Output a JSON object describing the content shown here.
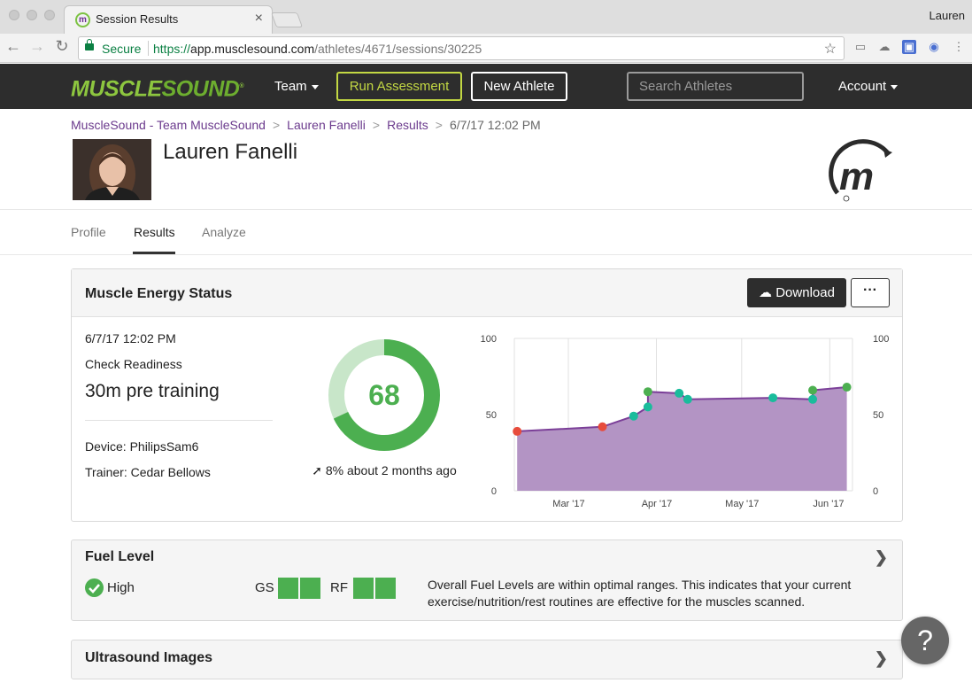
{
  "browser": {
    "tab_title": "Session Results",
    "tab_favicon": "m",
    "profile_name": "Lauren",
    "security_label": "Secure",
    "url_scheme": "https://",
    "url_host": "app.musclesound.com",
    "url_path": "/athletes/4671/sessions/30225"
  },
  "navbar": {
    "logo_part1": "MUSCLE",
    "logo_part2": "SOUND",
    "logo_mark": "®",
    "team_label": "Team",
    "run_assessment_label": "Run Assessment",
    "new_athlete_label": "New Athlete",
    "search_placeholder": "Search Athletes",
    "account_label": "Account"
  },
  "breadcrumb": {
    "items": [
      "MuscleSound - Team MuscleSound",
      "Lauren Fanelli",
      "Results"
    ],
    "current": "6/7/17 12:02 PM",
    "separator": ">"
  },
  "athlete": {
    "name": "Lauren Fanelli"
  },
  "tabs": [
    "Profile",
    "Results",
    "Analyze"
  ],
  "active_tab": "Results",
  "muscle_energy": {
    "title": "Muscle Energy Status",
    "download_label": "Download",
    "more_label": "···",
    "date": "6/7/17 12:02 PM",
    "type": "Check Readiness",
    "timing": "30m pre training",
    "device": "Device: PhilipsSam6",
    "trainer": "Trainer: Cedar Bellows",
    "score": "68",
    "score_value": 68,
    "trend_icon": "arrow-up-right-icon",
    "trend_text": "8% about 2 months ago",
    "colors": {
      "score": "#4caf50",
      "score_track": "#c8e6c9",
      "chart_fill": "#b394c4",
      "chart_line": "#7b3f98"
    }
  },
  "chart_data": {
    "type": "area",
    "x_ticks": [
      "Mar '17",
      "Apr '17",
      "May '17",
      "Jun '17"
    ],
    "y_ticks": [
      "100",
      "50",
      "0"
    ],
    "ylim": [
      0,
      100
    ],
    "grid": true,
    "series": [
      {
        "points": [
          {
            "date": "2017-02-11",
            "y": 39,
            "status": "red"
          },
          {
            "date": "2017-03-13",
            "y": 42,
            "status": "red"
          },
          {
            "date": "2017-03-24",
            "y": 49,
            "status": "teal"
          },
          {
            "date": "2017-03-29",
            "y": 55,
            "status": "teal"
          },
          {
            "date": "2017-03-29",
            "y": 65,
            "status": "green"
          },
          {
            "date": "2017-04-09",
            "y": 64,
            "status": "teal"
          },
          {
            "date": "2017-04-12",
            "y": 60,
            "status": "teal"
          },
          {
            "date": "2017-05-12",
            "y": 61,
            "status": "teal"
          },
          {
            "date": "2017-05-26",
            "y": 60,
            "status": "teal"
          },
          {
            "date": "2017-05-26",
            "y": 66,
            "status": "green"
          },
          {
            "date": "2017-06-07",
            "y": 68,
            "status": "green"
          }
        ]
      }
    ],
    "marker_colors": {
      "red": "#e74c3c",
      "teal": "#1abc9c",
      "green": "#4caf50"
    }
  },
  "fuel_level": {
    "title": "Fuel Level",
    "status": "High",
    "muscles": [
      {
        "label": "GS",
        "bars": 2
      },
      {
        "label": "RF",
        "bars": 2
      }
    ],
    "description": "Overall Fuel Levels are within optimal ranges. This indicates that your current exercise/nutrition/rest routines are effective for the muscles scanned."
  },
  "ultrasound": {
    "title": "Ultrasound Images"
  },
  "help_label": "?"
}
